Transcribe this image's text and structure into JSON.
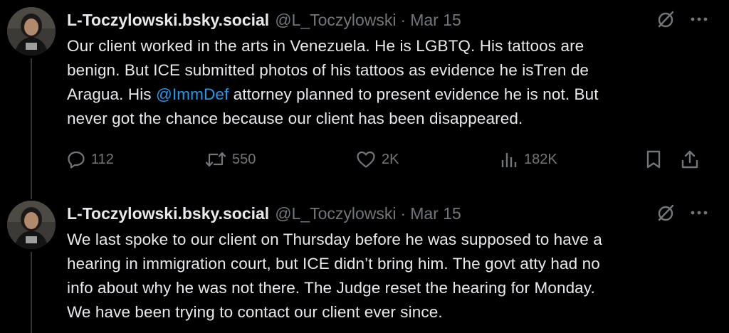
{
  "colors": {
    "background": "#000000",
    "text_primary": "#e7e9ea",
    "text_secondary": "#71767b",
    "link": "#1d9bf0",
    "thread_line": "#333639"
  },
  "tweets": [
    {
      "author_name": "L-Toczylowski.bsky.social",
      "handle": "@L_Toczylowski",
      "separator": "·",
      "date": "Mar 15",
      "text_lines": [
        [
          "Our client worked in the arts in Venezuela. He is LGBTQ. His tattoos are"
        ],
        [
          "benign. But ICE submitted photos of his tattoos as evidence he isTren de"
        ],
        [
          "Aragua. His ",
          "@ImmDef",
          " attorney planned to present evidence he is not. But"
        ],
        [
          "never got the chance because our client has been disappeared."
        ]
      ],
      "replies": "112",
      "reposts": "550",
      "likes": "2K",
      "views": "182K",
      "icons": [
        "grok-icon",
        "more-icon",
        "reply-icon",
        "repost-icon",
        "like-icon",
        "views-icon",
        "bookmark-icon",
        "share-icon"
      ]
    },
    {
      "author_name": "L-Toczylowski.bsky.social",
      "handle": "@L_Toczylowski",
      "separator": "·",
      "date": "Mar 15",
      "text_lines": [
        [
          "We last spoke to our client on Thursday before he was supposed to have a"
        ],
        [
          "hearing in immigration court,  but ICE didn’t bring him. The govt atty had no"
        ],
        [
          "info about why he was not there. The Judge reset the hearing for Monday."
        ],
        [
          "We have been trying to contact our client ever since."
        ]
      ],
      "icons": [
        "grok-icon",
        "more-icon"
      ]
    }
  ]
}
